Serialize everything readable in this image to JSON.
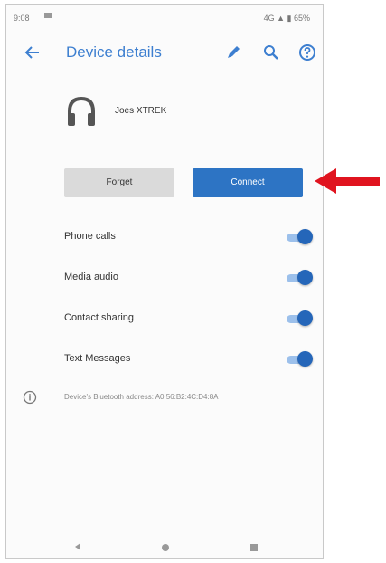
{
  "status_bar": {
    "time": "9:08",
    "right_text": "4G ▲ ▮ 65%"
  },
  "app_bar": {
    "title": "Device details",
    "icons": [
      "back-arrow-icon",
      "pencil-icon",
      "search-icon",
      "help-icon"
    ]
  },
  "device": {
    "name": "Joes XTREK",
    "icon": "headset-icon"
  },
  "buttons": {
    "forget": "Forget",
    "connect": "Connect"
  },
  "toggles": [
    {
      "label": "Phone calls",
      "on": true
    },
    {
      "label": "Media audio",
      "on": true
    },
    {
      "label": "Contact sharing",
      "on": true
    },
    {
      "label": "Text Messages",
      "on": true
    }
  ],
  "info": {
    "text": "Device's Bluetooth address: A0:56:B2:4C:D4:8A",
    "icon": "info-icon"
  },
  "annotation": {
    "icon": "red-arrow-icon",
    "color": "#e0141f"
  },
  "colors": {
    "accent": "#3d7fd0",
    "connect_button": "#2d74c4",
    "forget_button": "#dadada",
    "toggle_on": "#2566b9"
  }
}
